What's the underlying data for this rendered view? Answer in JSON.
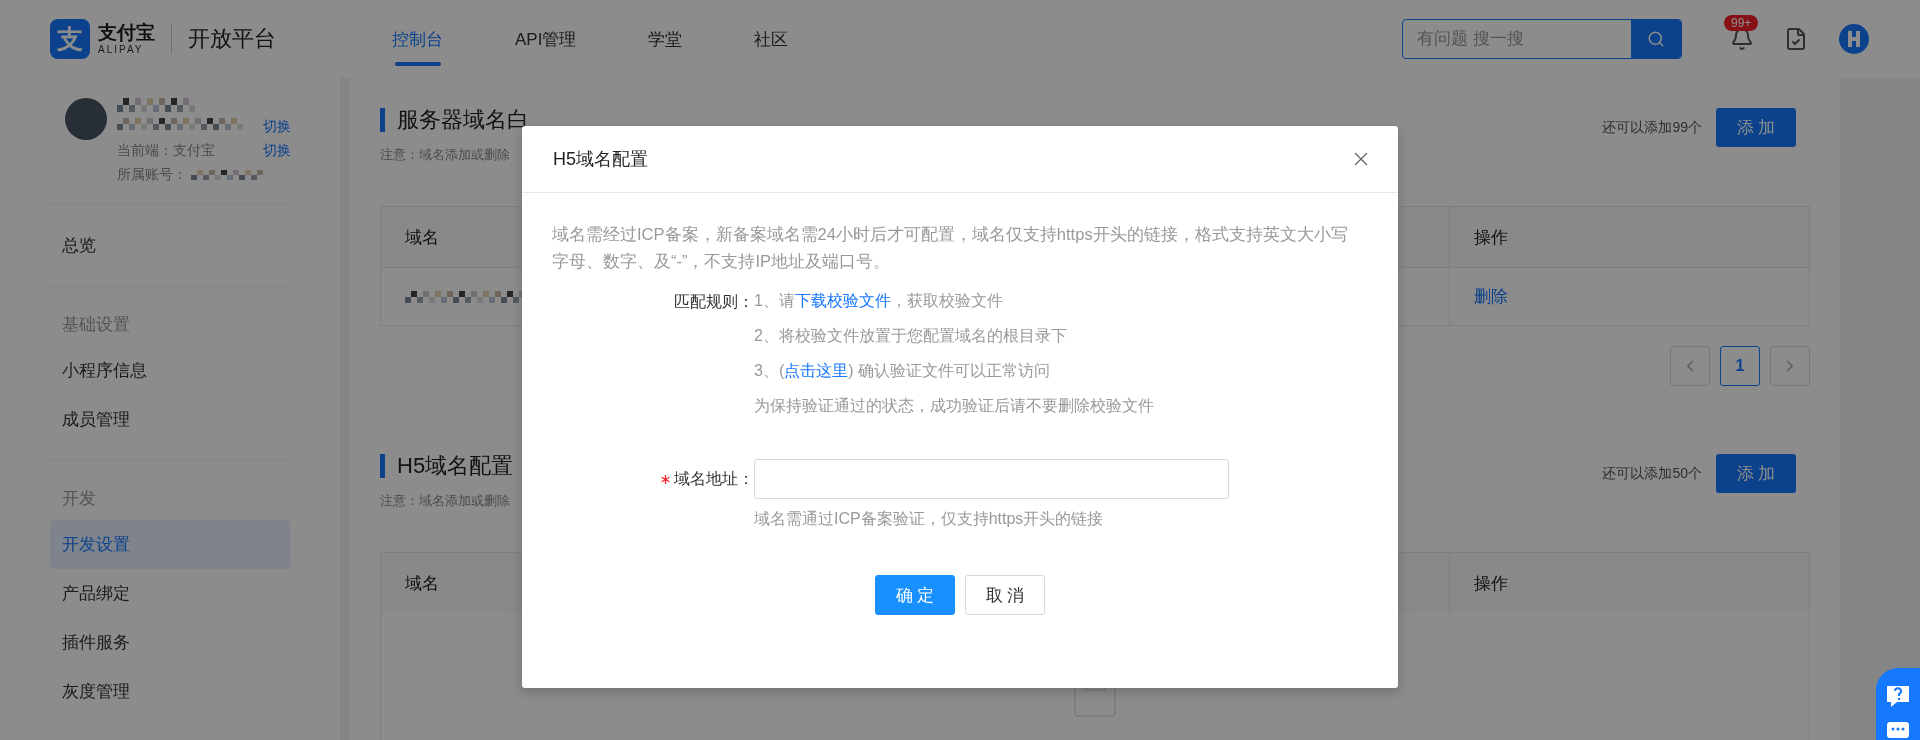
{
  "header": {
    "logo_glyph": "支",
    "logo_text": "支付宝",
    "logo_subtext": "ALIPAY",
    "platform": "开放平台",
    "nav": [
      {
        "label": "控制台",
        "selected": true
      },
      {
        "label": "API管理",
        "selected": false
      },
      {
        "label": "学堂",
        "selected": false
      },
      {
        "label": "社区",
        "selected": false
      }
    ],
    "search": {
      "placeholder": "有问题 搜一搜"
    },
    "notification_badge": "99+"
  },
  "sidebar": {
    "account": {
      "switch_links": [
        "切换",
        "切换"
      ],
      "client_label": "当前端：支付宝",
      "account_label": "所属账号："
    },
    "groups": [
      {
        "items": [
          {
            "label": "总览",
            "selected": false
          }
        ]
      },
      {
        "heading": "基础设置",
        "items": [
          {
            "label": "小程序信息",
            "selected": false
          },
          {
            "label": "成员管理",
            "selected": false
          }
        ]
      },
      {
        "heading": "开发",
        "items": [
          {
            "label": "开发设置",
            "selected": true
          },
          {
            "label": "产品绑定",
            "selected": false
          },
          {
            "label": "插件服务",
            "selected": false
          },
          {
            "label": "灰度管理",
            "selected": false
          }
        ]
      }
    ]
  },
  "sections": [
    {
      "title": "服务器域名白",
      "note": "注意：域名添加或删除",
      "remaining": "还可以添加99个",
      "add_button": "添 加",
      "columns": [
        "域名",
        "操作"
      ],
      "rows": [
        {
          "action": "删除"
        }
      ],
      "pagination": {
        "pages": [
          {
            "label": "1",
            "selected": true
          }
        ]
      }
    },
    {
      "title": "H5域名配置",
      "note": "注意：域名添加或删除",
      "remaining": "还可以添加50个",
      "add_button": "添 加",
      "columns": [
        "域名",
        "操作"
      ]
    }
  ],
  "modal": {
    "title": "H5域名配置",
    "intro": "域名需经过ICP备案，新备案域名需24小时后才可配置，域名仅支持https开头的链接，格式支持英文大小写字母、数字、及“-”，不支持IP地址及端口号。",
    "rules_label": "匹配规则：",
    "rules": [
      [
        {
          "text": "1、请"
        },
        {
          "text": "下载校验文件",
          "link": true
        },
        {
          "text": "，获取校验文件"
        }
      ],
      [
        {
          "text": "2、将校验文件放置于您配置域名的根目录下"
        }
      ],
      [
        {
          "text": "3、("
        },
        {
          "text": "点击这里",
          "link": true
        },
        {
          "text": ") 确认验证文件可以正常访问"
        }
      ],
      [
        {
          "text": "为保持验证通过的状态，成功验证后请不要删除校验文件"
        }
      ]
    ],
    "field": {
      "label": "域名地址：",
      "required": true,
      "hint": "域名需通过ICP备案验证，仅支持https开头的链接"
    },
    "buttons": [
      {
        "label": "确 定",
        "primary": true
      },
      {
        "label": "取 消",
        "primary": false
      }
    ]
  }
}
